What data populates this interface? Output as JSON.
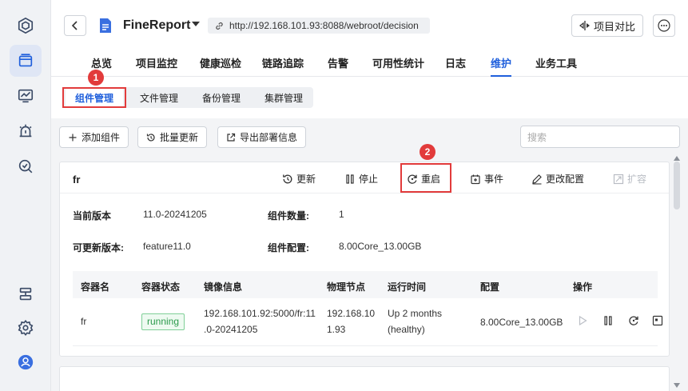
{
  "header": {
    "app_title": "FineReport",
    "url": "http://192.168.101.93:8088/webroot/decision",
    "compare_label": "项目对比"
  },
  "nav": {
    "items": [
      "总览",
      "项目监控",
      "健康巡检",
      "链路追踪",
      "告警",
      "可用性统计",
      "日志",
      "维护",
      "业务工具"
    ],
    "active": "维护"
  },
  "subtabs": {
    "items": [
      "组件管理",
      "文件管理",
      "备份管理",
      "集群管理"
    ],
    "active": "组件管理"
  },
  "annotations": [
    "1",
    "2"
  ],
  "toolbar": {
    "add_label": "添加组件",
    "batch_label": "批量更新",
    "export_label": "导出部署信息",
    "search_placeholder": "搜索"
  },
  "component": {
    "name": "fr",
    "actions": {
      "update": "更新",
      "stop": "停止",
      "restart": "重启",
      "event": "事件",
      "config": "更改配置",
      "scale": "扩容"
    },
    "info": {
      "current_version_label": "当前版本",
      "current_version": "11.0-20241205",
      "count_label": "组件数量:",
      "count": "1",
      "updatable_label": "可更新版本:",
      "updatable": "feature11.0",
      "config_label": "组件配置:",
      "config": "8.00Core_13.00GB"
    },
    "table": {
      "headers": [
        "容器名",
        "容器状态",
        "镜像信息",
        "物理节点",
        "运行时间",
        "配置",
        "操作"
      ],
      "rows": [
        {
          "name": "fr",
          "status": "running",
          "image_line1": "192.168.101.92:5000/fr:11",
          "image_line2": ".0-20241205",
          "node_line1": "192.168.10",
          "node_line2": "1.93",
          "uptime_line1": "Up 2 months",
          "uptime_line2": "(healthy)",
          "config": "8.00Core_13.00GB"
        }
      ]
    }
  }
}
